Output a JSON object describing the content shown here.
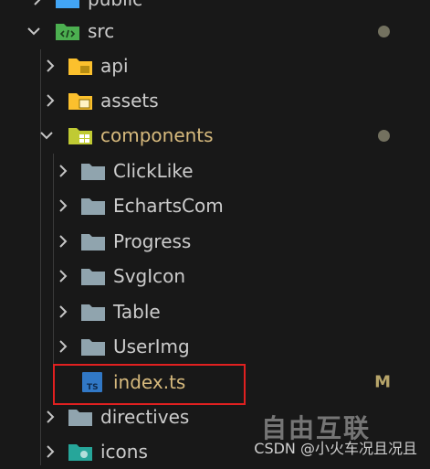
{
  "explorer": {
    "rows": [
      {
        "label": "public",
        "indent": 0,
        "expanded": false,
        "icon": "folder-public-icon"
      },
      {
        "label": "src",
        "indent": 0,
        "expanded": true,
        "icon": "folder-src-icon",
        "status": "dot"
      },
      {
        "label": "api",
        "indent": 1,
        "expanded": false,
        "icon": "folder-api-icon"
      },
      {
        "label": "assets",
        "indent": 1,
        "expanded": false,
        "icon": "folder-assets-icon"
      },
      {
        "label": "components",
        "indent": 1,
        "expanded": true,
        "icon": "folder-components-icon",
        "status": "dot"
      },
      {
        "label": "ClickLike",
        "indent": 2,
        "expanded": false,
        "icon": "folder-icon"
      },
      {
        "label": "EchartsCom",
        "indent": 2,
        "expanded": false,
        "icon": "folder-icon"
      },
      {
        "label": "Progress",
        "indent": 2,
        "expanded": false,
        "icon": "folder-icon"
      },
      {
        "label": "SvgIcon",
        "indent": 2,
        "expanded": false,
        "icon": "folder-icon"
      },
      {
        "label": "Table",
        "indent": 2,
        "expanded": false,
        "icon": "folder-icon"
      },
      {
        "label": "UserImg",
        "indent": 2,
        "expanded": false,
        "icon": "folder-icon"
      },
      {
        "label": "index.ts",
        "indent": 2,
        "file": true,
        "icon": "typescript-file-icon",
        "status": "M"
      },
      {
        "label": "directives",
        "indent": 1,
        "expanded": false,
        "icon": "folder-icon"
      },
      {
        "label": "icons",
        "indent": 1,
        "expanded": false,
        "icon": "folder-icons-icon"
      }
    ]
  },
  "status_modified": "M",
  "watermark": {
    "text": "CSDN @小火车况且况且",
    "logo": "自由互联"
  },
  "colors": {
    "background": "#181818",
    "text_default": "#cccccc",
    "text_modified": "#d7ba7d",
    "folder_gray": "#90a4ae",
    "folder_src": "#4caf50",
    "folder_api": "#fbc02d",
    "folder_assets": "#fbc02d",
    "folder_components": "#c0ca33",
    "folder_icons": "#26a69a",
    "ts_blue": "#3178c6",
    "highlight_red": "#e02020"
  }
}
